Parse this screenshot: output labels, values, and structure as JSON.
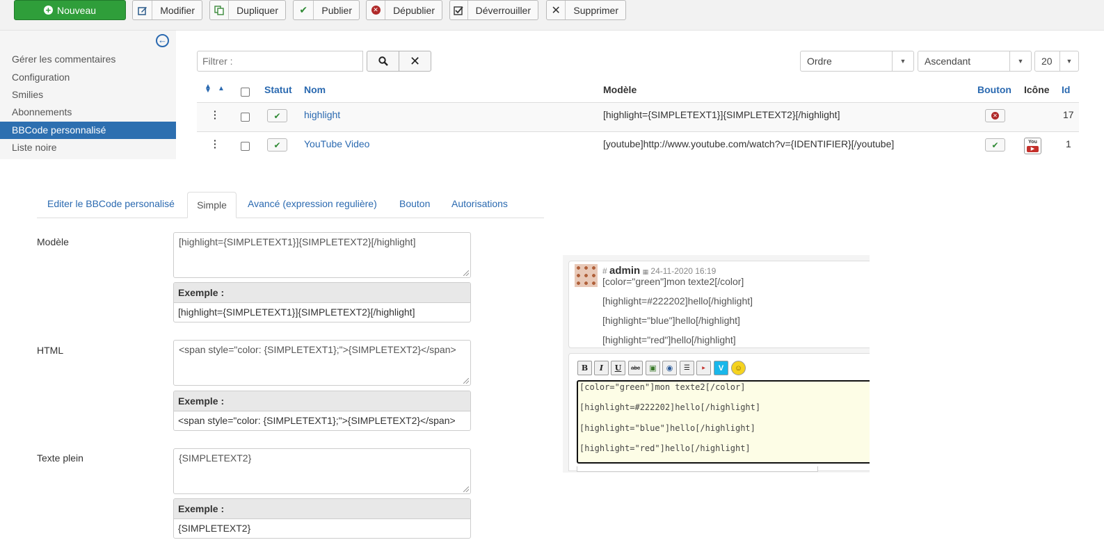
{
  "toolbar": {
    "new_label": "Nouveau",
    "buttons": [
      {
        "label": "Modifier",
        "icon": "edit-icon"
      },
      {
        "label": "Dupliquer",
        "icon": "copy-icon"
      },
      {
        "label": "Publier",
        "icon": "check-icon"
      },
      {
        "label": "Dépublier",
        "icon": "unpublish-icon"
      },
      {
        "label": "Déverrouiller",
        "icon": "checkbox-icon"
      },
      {
        "label": "Supprimer",
        "icon": "delete-icon"
      }
    ]
  },
  "sidebar": {
    "items": [
      {
        "label": "Gérer les commentaires"
      },
      {
        "label": "Configuration"
      },
      {
        "label": "Smilies"
      },
      {
        "label": "Abonnements"
      },
      {
        "label": "BBCode personnalisé"
      },
      {
        "label": "Liste noire"
      }
    ],
    "active_index": 4
  },
  "filter": {
    "placeholder": "Filtrer :",
    "order_select": "Ordre",
    "direction_select": "Ascendant",
    "limit_select": "20"
  },
  "table": {
    "headers": {
      "status": "Statut",
      "name": "Nom",
      "model": "Modèle",
      "button": "Bouton",
      "icon": "Icône",
      "id": "Id"
    },
    "rows": [
      {
        "name": "highlight",
        "model": "[highlight={SIMPLETEXT1}]{SIMPLETEXT2}[/highlight]",
        "id": "17"
      },
      {
        "name": "YouTube Video",
        "model": "[youtube]http://www.youtube.com/watch?v={IDENTIFIER}[/youtube]",
        "id": "1"
      }
    ]
  },
  "tabs": [
    {
      "label": "Editer le BBCode personalisé"
    },
    {
      "label": "Simple"
    },
    {
      "label": "Avancé (expression regulière)"
    },
    {
      "label": "Bouton"
    },
    {
      "label": "Autorisations"
    }
  ],
  "form": {
    "model_label": "Modèle",
    "model_value": "[highlight={SIMPLETEXT1}]{SIMPLETEXT2}[/highlight]",
    "html_label": "HTML",
    "html_value": "<span style=\"color: {SIMPLETEXT1};\">{SIMPLETEXT2}</span>",
    "plain_label": "Texte plein",
    "plain_value": "{SIMPLETEXT2}",
    "example_label": "Exemple :"
  },
  "preview": {
    "hash": "#",
    "author": "admin",
    "date": "24-11-2020 16:19",
    "lines": [
      "[color=\"green\"]mon texte2[/color]",
      "[highlight=#222202]hello[/highlight]",
      "[highlight=\"blue\"]hello[/highlight]",
      "[highlight=\"red\"]hello[/highlight]"
    ]
  },
  "editor": {
    "youtube_icon_text": "You",
    "lines": [
      "[color=\"green\"]mon texte2[/color]",
      "[highlight=#222202]hello[/highlight]",
      "[highlight=\"blue\"]hello[/highlight]",
      "[highlight=\"red\"]hello[/highlight]"
    ]
  },
  "colors": {
    "accent": "#2a69b0",
    "new_button": "#2f9e3a",
    "active_sidebar": "#2d6fb0"
  }
}
